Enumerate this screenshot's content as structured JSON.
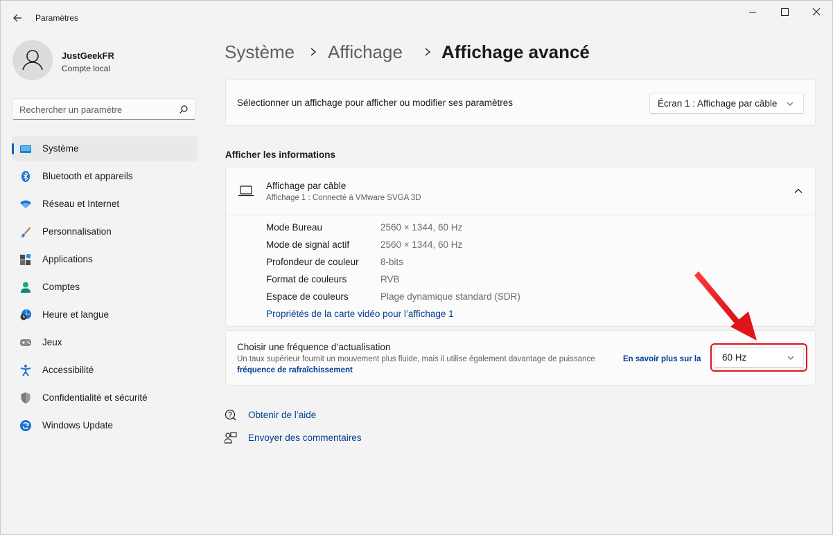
{
  "window": {
    "title": "Paramètres"
  },
  "user": {
    "name": "JustGeekFR",
    "account_type": "Compte local"
  },
  "search": {
    "placeholder": "Rechercher un paramètre"
  },
  "sidebar": {
    "items": [
      {
        "label": "Système",
        "icon": "monitor-icon",
        "active": true
      },
      {
        "label": "Bluetooth et appareils",
        "icon": "bluetooth-icon"
      },
      {
        "label": "Réseau et Internet",
        "icon": "wifi-icon"
      },
      {
        "label": "Personnalisation",
        "icon": "brush-icon"
      },
      {
        "label": "Applications",
        "icon": "apps-icon"
      },
      {
        "label": "Comptes",
        "icon": "person-icon"
      },
      {
        "label": "Heure et langue",
        "icon": "clock-globe-icon"
      },
      {
        "label": "Jeux",
        "icon": "gamepad-icon"
      },
      {
        "label": "Accessibilité",
        "icon": "accessibility-icon"
      },
      {
        "label": "Confidentialité et sécurité",
        "icon": "shield-icon"
      },
      {
        "label": "Windows Update",
        "icon": "update-icon"
      }
    ]
  },
  "breadcrumb": {
    "level1": "Système",
    "level2": "Affichage",
    "current": "Affichage avancé"
  },
  "select_display": {
    "label": "Sélectionner un affichage pour afficher ou modifier ses paramètres",
    "value": "Écran 1 : Affichage par câble"
  },
  "info_section": {
    "heading": "Afficher les informations"
  },
  "display_info": {
    "title": "Affichage par câble",
    "subtitle": "Affichage 1 : Connecté à VMware SVGA 3D",
    "rows": [
      {
        "label": "Mode Bureau",
        "value": "2560 × 1344, 60 Hz"
      },
      {
        "label": "Mode de signal actif",
        "value": "2560 × 1344, 60 Hz"
      },
      {
        "label": "Profondeur de couleur",
        "value": "8-bits"
      },
      {
        "label": "Format de couleurs",
        "value": "RVB"
      },
      {
        "label": "Espace de couleurs",
        "value": "Plage dynamique standard (SDR)"
      }
    ],
    "adapter_link": "Propriétés de la carte vidéo pour l’affichage 1"
  },
  "refresh": {
    "title": "Choisir une fréquence d’actualisation",
    "description": "Un taux supérieur fournit un mouvement plus fluide, mais il utilise également davantage de puissance",
    "link_part1": "En savoir plus sur la",
    "link_part2": "fréquence de rafraîchissement",
    "value": "60 Hz"
  },
  "help": {
    "get_help": "Obtenir de l’aide",
    "feedback": "Envoyer des commentaires"
  },
  "colors": {
    "accent": "#0067c0",
    "link": "#003e92",
    "highlight": "#e0141b"
  }
}
